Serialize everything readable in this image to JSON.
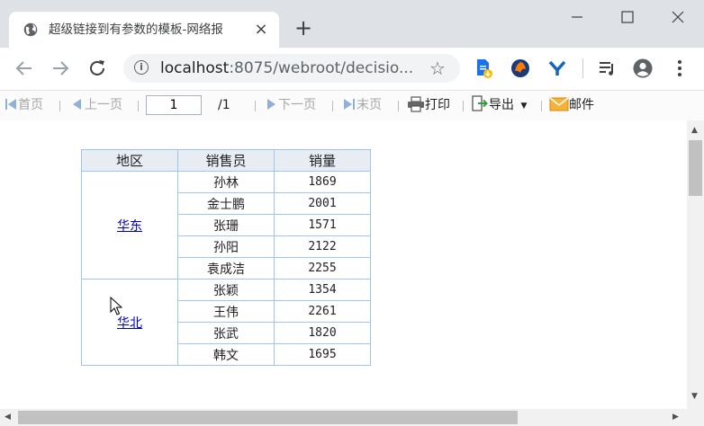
{
  "browser": {
    "tab_title": "超级链接到有参数的模板-网络报",
    "tab_close": "×",
    "new_tab": "+",
    "url_host": "localhost",
    "url_rest": ":8075/webroot/decisio..."
  },
  "report_toolbar": {
    "first": "首页",
    "prev": "上一页",
    "page_value": "1",
    "page_total": "/1",
    "next": "下一页",
    "last": "末页",
    "print": "打印",
    "export": "导出",
    "mail": "邮件"
  },
  "table": {
    "headers": [
      "地区",
      "销售员",
      "销量"
    ],
    "groups": [
      {
        "region": "华东",
        "rows": [
          [
            "孙林",
            "1869"
          ],
          [
            "金士鹏",
            "2001"
          ],
          [
            "张珊",
            "1571"
          ],
          [
            "孙阳",
            "2122"
          ],
          [
            "袁成洁",
            "2255"
          ]
        ]
      },
      {
        "region": "华北",
        "rows": [
          [
            "张颖",
            "1354"
          ],
          [
            "王伟",
            "2261"
          ],
          [
            "张武",
            "1820"
          ],
          [
            "韩文",
            "1695"
          ]
        ]
      }
    ]
  },
  "colors": {
    "link": "#0000cc",
    "table_border": "#9fc5e8",
    "header_bg": "#e8edf3"
  }
}
